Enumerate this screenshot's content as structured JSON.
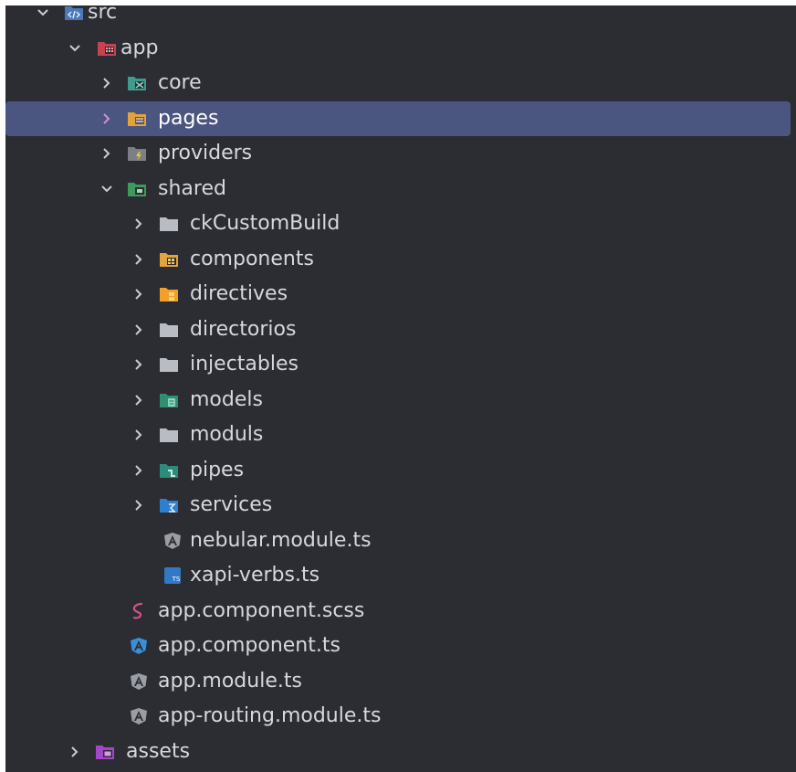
{
  "tree": {
    "items": [
      {
        "label": "src",
        "expanded": true,
        "icon": "source-folder-icon"
      },
      {
        "label": "app",
        "expanded": true,
        "icon": "app-folder-icon"
      },
      {
        "label": "core",
        "expanded": false,
        "icon": "core-folder-icon"
      },
      {
        "label": "pages",
        "expanded": false,
        "icon": "pages-folder-icon",
        "selected": true
      },
      {
        "label": "providers",
        "expanded": false,
        "icon": "providers-folder-icon"
      },
      {
        "label": "shared",
        "expanded": true,
        "icon": "shared-folder-icon"
      },
      {
        "label": "ckCustomBuild",
        "expanded": false,
        "icon": "folder-icon"
      },
      {
        "label": "components",
        "expanded": false,
        "icon": "components-folder-icon"
      },
      {
        "label": "directives",
        "expanded": false,
        "icon": "directives-folder-icon"
      },
      {
        "label": "directorios",
        "expanded": false,
        "icon": "folder-icon"
      },
      {
        "label": "injectables",
        "expanded": false,
        "icon": "folder-icon"
      },
      {
        "label": "models",
        "expanded": false,
        "icon": "models-folder-icon"
      },
      {
        "label": "moduls",
        "expanded": false,
        "icon": "folder-icon"
      },
      {
        "label": "pipes",
        "expanded": false,
        "icon": "pipes-folder-icon"
      },
      {
        "label": "services",
        "expanded": false,
        "icon": "services-folder-icon"
      },
      {
        "label": "nebular.module.ts",
        "icon": "angular-module-icon"
      },
      {
        "label": "xapi-verbs.ts",
        "icon": "typescript-file-icon"
      },
      {
        "label": "app.component.scss",
        "icon": "sass-file-icon"
      },
      {
        "label": "app.component.ts",
        "icon": "angular-component-icon"
      },
      {
        "label": "app.module.ts",
        "icon": "angular-module-icon"
      },
      {
        "label": "app-routing.module.ts",
        "icon": "angular-module-icon"
      },
      {
        "label": "assets",
        "expanded": false,
        "icon": "assets-folder-icon"
      }
    ]
  },
  "colors": {
    "background": "#2b2d33",
    "selection": "#4b5680",
    "text": "#d6d8dd"
  }
}
